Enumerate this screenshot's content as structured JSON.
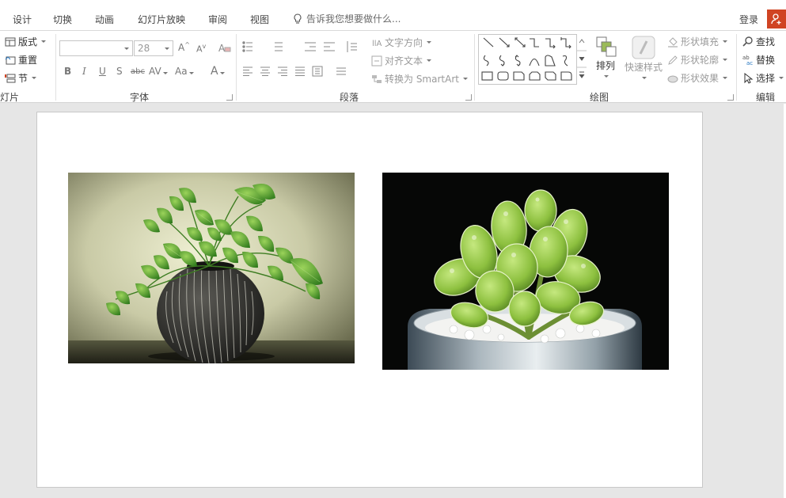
{
  "tabs": [
    "设计",
    "切换",
    "动画",
    "幻灯片放映",
    "审阅",
    "视图"
  ],
  "tell_me": "告诉我您想要做什么...",
  "login": "登录",
  "ribbon": {
    "slides": {
      "layout": "版式",
      "reset": "重置",
      "section": "节",
      "label": "灯片"
    },
    "font": {
      "size": "28",
      "label": "字体"
    },
    "paragraph": {
      "text_direction": "文字方向",
      "align_text": "对齐文本",
      "convert_smartart": "转换为 SmartArt",
      "label": "段落"
    },
    "drawing": {
      "arrange": "排列",
      "quick_styles": "快速样式",
      "shape_fill": "形状填充",
      "shape_outline": "形状轮廓",
      "shape_effects": "形状效果",
      "label": "绘图"
    },
    "editing": {
      "find": "查找",
      "replace": "替换",
      "select": "选择",
      "label": "编辑"
    }
  },
  "slide": {
    "pictures": [
      {
        "name": "pothos-in-striped-pot"
      },
      {
        "name": "succulent-in-glass-pot"
      }
    ]
  },
  "colors": {
    "accent": "#d04423",
    "slide_bg": "#ffffff",
    "workspace": "#e6e6e6"
  }
}
